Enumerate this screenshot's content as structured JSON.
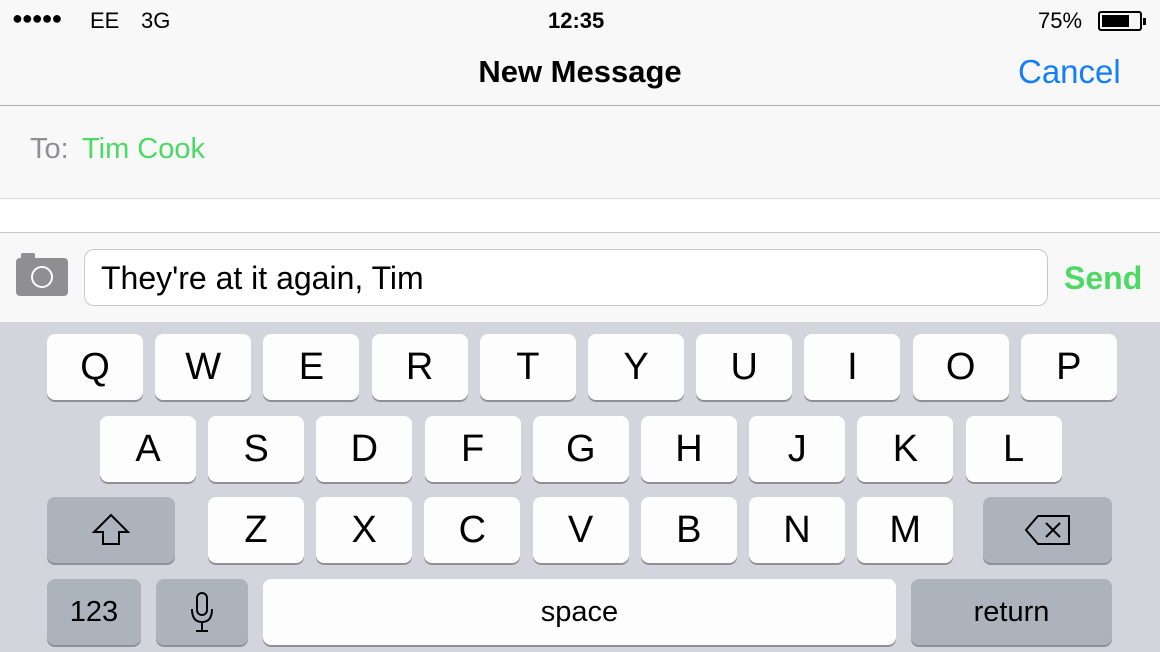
{
  "status": {
    "signal": "●●●●●",
    "carrier": "EE",
    "network": "3G",
    "time": "12:35",
    "battery": "75%",
    "battery_level": 0.75
  },
  "nav": {
    "title": "New Message",
    "cancel": "Cancel"
  },
  "to": {
    "label": "To:",
    "recipient": "Tim Cook"
  },
  "compose": {
    "text": "They're at it again, Tim",
    "send": "Send",
    "camera_icon": "camera-icon"
  },
  "keyboard": {
    "row1": [
      "Q",
      "W",
      "E",
      "R",
      "T",
      "Y",
      "U",
      "I",
      "O",
      "P"
    ],
    "row2": [
      "A",
      "S",
      "D",
      "F",
      "G",
      "H",
      "J",
      "K",
      "L"
    ],
    "row3": [
      "Z",
      "X",
      "C",
      "V",
      "B",
      "N",
      "M"
    ],
    "numbers": "123",
    "space": "space",
    "return": "return"
  },
  "colors": {
    "accent": "#157efb",
    "green": "#4cd964"
  }
}
